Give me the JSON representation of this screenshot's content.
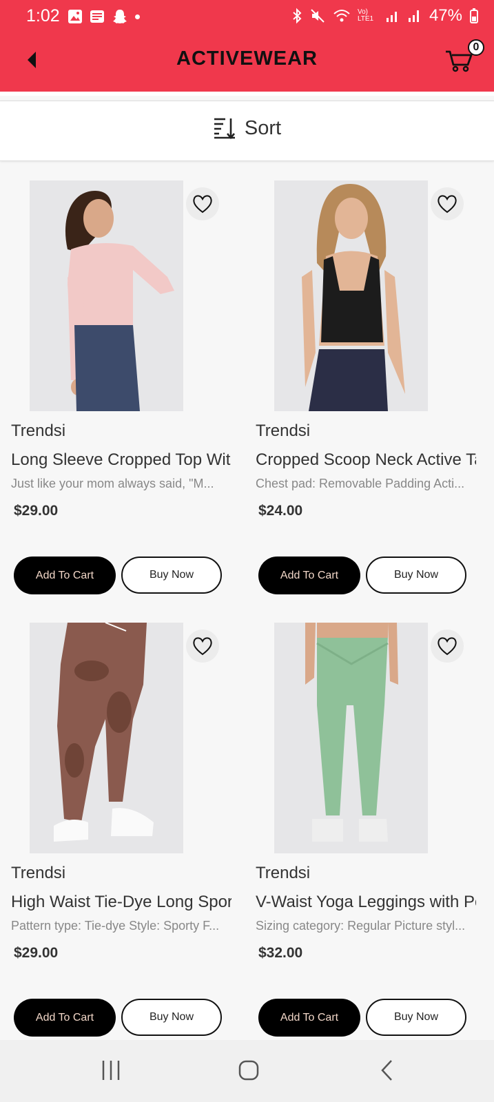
{
  "status_bar": {
    "time": "1:02",
    "network": "Vo) LTE1",
    "battery": "47%"
  },
  "header": {
    "title": "ACTIVEWEAR",
    "cart_count": "0",
    "accent_color": "#f0384c"
  },
  "sort": {
    "label": "Sort"
  },
  "products": [
    {
      "brand": "Trendsi",
      "name": "Long Sleeve Cropped Top With Sports Strap",
      "description": "Just like your mom always said, \"M...",
      "price": "$29.00",
      "add_to_cart": "Add To Cart",
      "buy_now": "Buy Now",
      "image": "woman in pink long-sleeve cropped top and navy leggings"
    },
    {
      "brand": "Trendsi",
      "name": "Cropped Scoop Neck Active Tank Top",
      "description": "Chest pad: Removable Padding Acti...",
      "price": "$24.00",
      "add_to_cart": "Add To Cart",
      "buy_now": "Buy Now",
      "image": "woman in black cropped tank top and navy leggings"
    },
    {
      "brand": "Trendsi",
      "name": "High Waist Tie-Dye Long Sports Pants",
      "description": "Pattern type: Tie-dye Style: Sporty F...",
      "price": "$29.00",
      "add_to_cart": "Add To Cart",
      "buy_now": "Buy Now",
      "image": "brown tie-dye high waist leggings with white sneakers"
    },
    {
      "brand": "Trendsi",
      "name": "V-Waist Yoga Leggings with Pockets",
      "description": "Sizing category: Regular Picture styl...",
      "price": "$32.00",
      "add_to_cart": "Add To Cart",
      "buy_now": "Buy Now",
      "image": "mint green v-waist leggings with white sneakers"
    }
  ],
  "icons": {
    "back": "back-triangle-icon",
    "cart": "cart-icon",
    "sort": "sort-icon",
    "favorite": "heart-icon"
  }
}
